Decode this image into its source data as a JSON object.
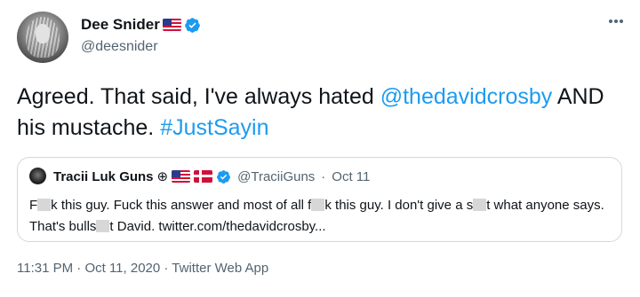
{
  "author": {
    "display_name": "Dee Snider",
    "handle": "@deesnider",
    "flags": [
      "us"
    ],
    "verified": true
  },
  "tweet": {
    "text_1": "Agreed. That said, I've always hated ",
    "mention": "@thedavidcrosby",
    "text_2": " AND his mustache. ",
    "hashtag": "#JustSayin"
  },
  "quoted": {
    "display_name": "Tracii Luk Guns",
    "symbol": "⊕",
    "flags": [
      "us",
      "dk"
    ],
    "verified": true,
    "handle": "@TraciiGuns",
    "separator": "·",
    "date": "Oct 11",
    "text_1": "F",
    "text_2": "k this guy. Fuck this answer and most of all f",
    "text_3": "k this guy. I don't give a s",
    "text_4": "t what anyone says. That's bulls",
    "text_5": "t David. twitter.com/thedavidcrosby..."
  },
  "meta": {
    "time": "11:31 PM",
    "date": "Oct 11, 2020",
    "source": "Twitter Web App",
    "separator": "·"
  },
  "colors": {
    "link": "#1d9bf0",
    "secondary_text": "#536471",
    "border": "#cfd9de"
  },
  "icons": {
    "more": "more-horizontal-icon",
    "verified": "verified-badge-icon"
  }
}
